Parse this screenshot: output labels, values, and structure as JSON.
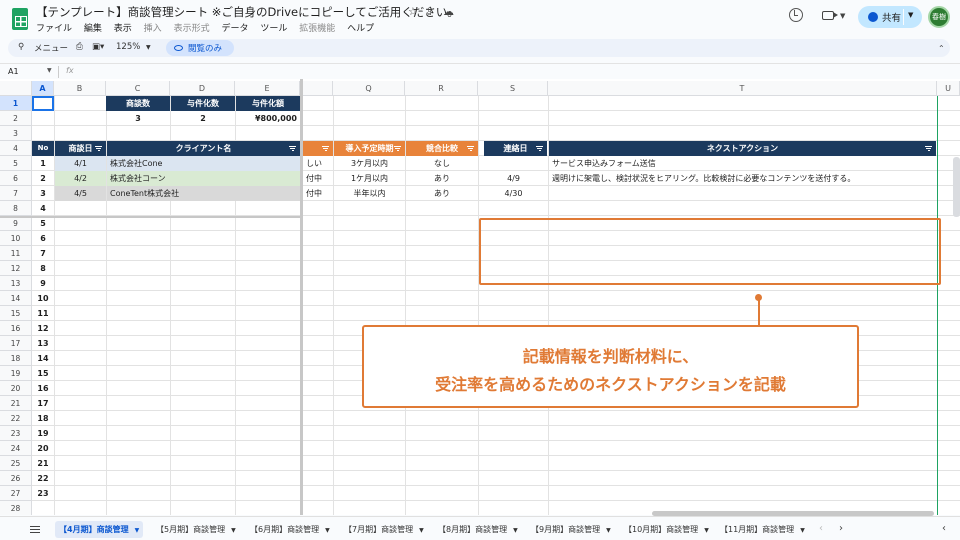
{
  "app": {
    "doc_title": "【テンプレート】商談管理シート ※ご自身のDriveにコピーしてご活用ください。",
    "menus": [
      {
        "label": "ファイル",
        "dim": false
      },
      {
        "label": "編集",
        "dim": false
      },
      {
        "label": "表示",
        "dim": false
      },
      {
        "label": "挿入",
        "dim": true
      },
      {
        "label": "表示形式",
        "dim": true
      },
      {
        "label": "データ",
        "dim": false
      },
      {
        "label": "ツール",
        "dim": false
      },
      {
        "label": "拡張機能",
        "dim": true
      },
      {
        "label": "ヘルプ",
        "dim": false
      }
    ],
    "share_label": "共有",
    "avatar_text": "春樹",
    "colors": {
      "navy": "#1c3a5e",
      "orange": "#e8833a",
      "accent_blue": "#0b57d0",
      "callout": "#e07a35"
    }
  },
  "toolbar": {
    "menu_label": "メニュー",
    "zoom": "125%",
    "view_only": "閲覧のみ"
  },
  "formula_bar": {
    "cell_ref": "A1",
    "fx": "fx",
    "content": ""
  },
  "sheet": {
    "columns": [
      {
        "label": "A",
        "sel": true
      },
      {
        "label": "B"
      },
      {
        "label": "C"
      },
      {
        "label": "D"
      },
      {
        "label": "E"
      },
      {
        "label": ""
      },
      {
        "label": "Q"
      },
      {
        "label": "R"
      },
      {
        "label": "S"
      },
      {
        "label": "T"
      },
      {
        "label": "U"
      }
    ],
    "row_numbers": [
      "1",
      "2",
      "3",
      "4",
      "5",
      "6",
      "7",
      "8",
      "9",
      "10",
      "11",
      "12",
      "13",
      "14",
      "15",
      "16",
      "17",
      "18",
      "19",
      "20",
      "21",
      "22",
      "23",
      "24",
      "25",
      "26",
      "27",
      "28"
    ],
    "summary": {
      "headers": [
        "商談数",
        "与件化数",
        "与件化額"
      ],
      "values": [
        "3",
        "2",
        "¥800,000"
      ]
    },
    "left_headers": [
      "No",
      "商談日",
      "クライアント名"
    ],
    "right_headers": [
      "",
      "導入予定時期",
      "競合比較",
      "連絡日",
      "ネクストアクション"
    ],
    "rows": [
      {
        "no": "1",
        "date": "4/1",
        "client": "株式会社Cone",
        "status": "しい",
        "timing": "3ケ月以内",
        "compare": "なし",
        "contact": "",
        "next": "サービス申込みフォーム送信"
      },
      {
        "no": "2",
        "date": "4/2",
        "client": "株式会社コーン",
        "status": "付中",
        "timing": "1ケ月以内",
        "compare": "あり",
        "contact": "4/9",
        "next": "週明けに架電し、検討状況をヒアリング。比較検討に必要なコンテンツを送付する。"
      },
      {
        "no": "3",
        "date": "4/5",
        "client": "ConeTent株式会社",
        "status": "付中",
        "timing": "半年以内",
        "compare": "あり",
        "contact": "4/30",
        "next": ""
      }
    ],
    "empty_nos": [
      "4",
      "5",
      "6",
      "7",
      "8",
      "9",
      "10",
      "11",
      "12",
      "13",
      "14",
      "15",
      "16",
      "17",
      "18",
      "19",
      "20",
      "21",
      "22",
      "23"
    ]
  },
  "callout": {
    "line1": "記載情報を判断材料に、",
    "line2": "受注率を高めるためのネクストアクションを記載"
  },
  "tabs": [
    {
      "label": "【4月期】商談管理",
      "active": true
    },
    {
      "label": "【5月期】商談管理"
    },
    {
      "label": "【6月期】商談管理"
    },
    {
      "label": "【7月期】商談管理"
    },
    {
      "label": "【8月期】商談管理"
    },
    {
      "label": "【9月期】商談管理"
    },
    {
      "label": "【10月期】商談管理"
    },
    {
      "label": "【11月期】商談管理"
    }
  ]
}
